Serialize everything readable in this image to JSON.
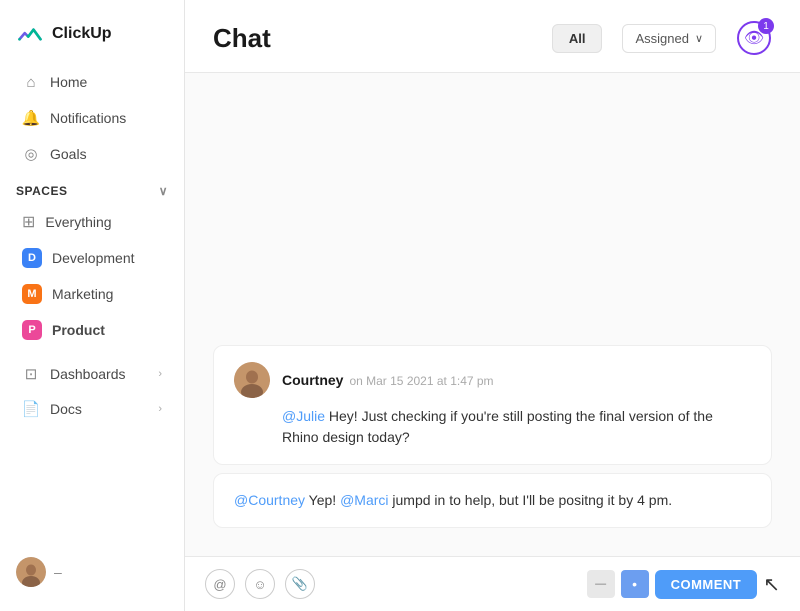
{
  "app": {
    "logo_text": "ClickUp"
  },
  "sidebar": {
    "nav": [
      {
        "id": "home",
        "label": "Home",
        "icon": "🏠"
      },
      {
        "id": "notifications",
        "label": "Notifications",
        "icon": "🔔"
      },
      {
        "id": "goals",
        "label": "Goals",
        "icon": "🎯"
      }
    ],
    "spaces_label": "Spaces",
    "spaces": [
      {
        "id": "everything",
        "label": "Everything",
        "type": "grid"
      },
      {
        "id": "development",
        "label": "Development",
        "badge": "D",
        "color": "badge-blue"
      },
      {
        "id": "marketing",
        "label": "Marketing",
        "badge": "M",
        "color": "badge-orange"
      },
      {
        "id": "product",
        "label": "Product",
        "badge": "P",
        "color": "badge-pink",
        "bold": true
      }
    ],
    "bottom_nav": [
      {
        "id": "dashboards",
        "label": "Dashboards"
      },
      {
        "id": "docs",
        "label": "Docs"
      }
    ]
  },
  "main": {
    "title": "Chat",
    "filter_all": "All",
    "filter_assigned": "Assigned",
    "badge_count": "1"
  },
  "messages": [
    {
      "id": "msg1",
      "author": "Courtney",
      "time": "on Mar 15 2021 at 1:47 pm",
      "body_mention": "@Julie",
      "body_text": " Hey! Just checking if you're still posting the final version of the Rhino design today?"
    }
  ],
  "reply": {
    "mention1": "@Courtney",
    "text1": " Yep! ",
    "mention2": "@Marci",
    "text2": " jumpd in to help, but I'll be positng it by 4 pm."
  },
  "input": {
    "comment_label": "COMMENT"
  }
}
